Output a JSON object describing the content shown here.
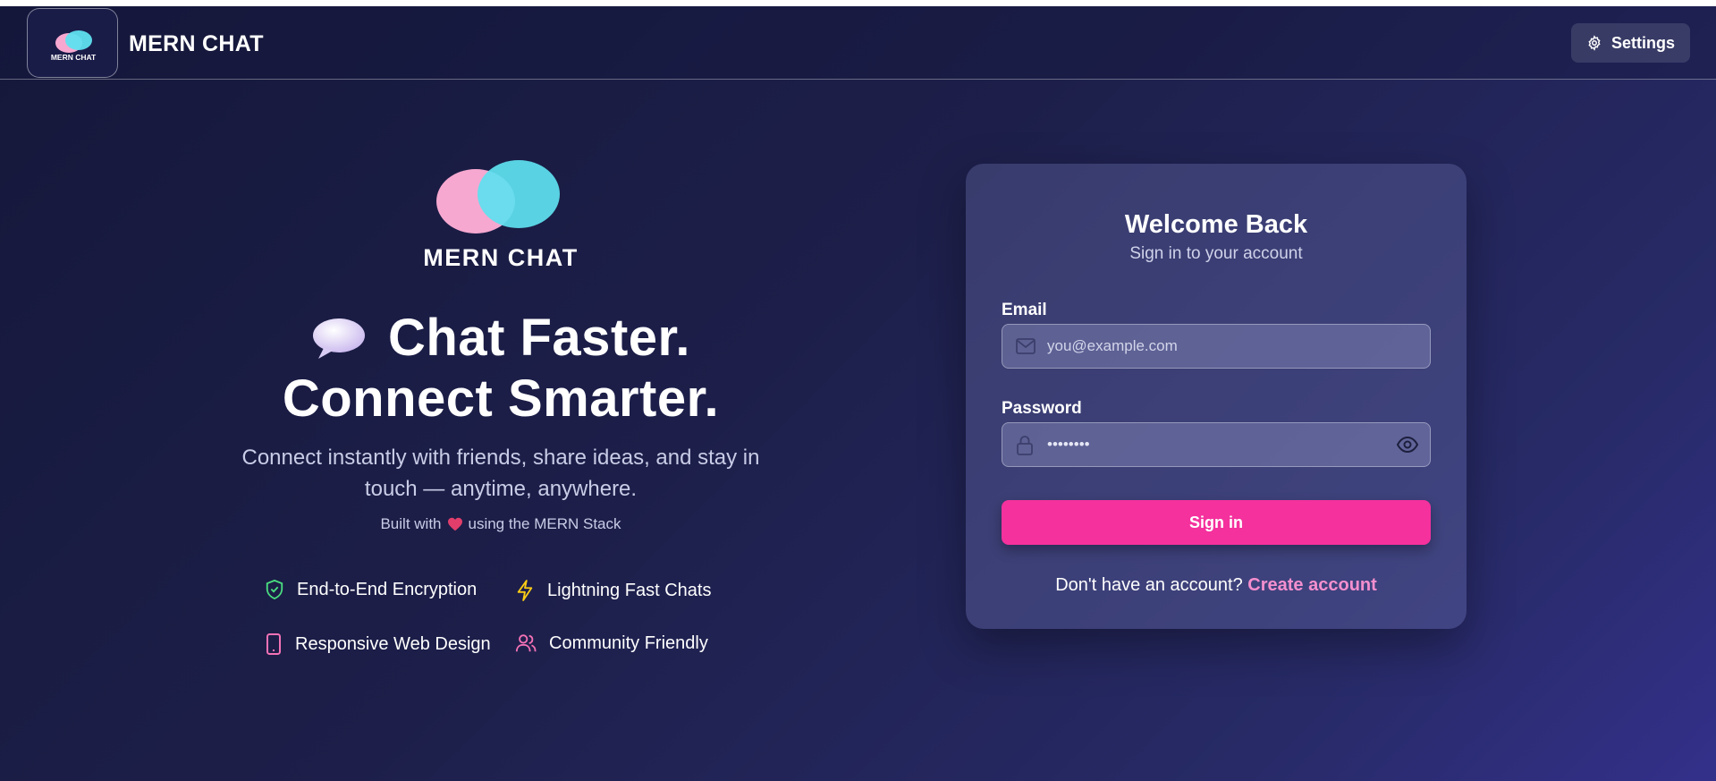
{
  "header": {
    "brand_name": "MERN CHAT",
    "logo_text": "MERN CHAT",
    "settings_label": "Settings"
  },
  "hero": {
    "logo_text": "MERN CHAT",
    "title_line1": "Chat Faster.",
    "title_line2": "Connect Smarter.",
    "subtitle": "Connect instantly with friends, share ideas, and stay in touch — anytime, anywhere.",
    "built_prefix": "Built with",
    "built_suffix": "using the MERN Stack",
    "features": [
      {
        "label": "End-to-End Encryption",
        "icon": "shield-check-icon",
        "color": "#4ade80"
      },
      {
        "label": "Lightning Fast Chats",
        "icon": "lightning-icon",
        "color": "#facc15"
      },
      {
        "label": "Responsive Web Design",
        "icon": "smartphone-icon",
        "color": "#f472b6"
      },
      {
        "label": "Community Friendly",
        "icon": "users-icon",
        "color": "#f472b6"
      }
    ]
  },
  "login": {
    "title": "Welcome Back",
    "subtitle": "Sign in to your account",
    "email_label": "Email",
    "email_placeholder": "you@example.com",
    "password_label": "Password",
    "password_value": "••••••••",
    "submit_label": "Sign in",
    "signup_prompt": "Don't have an account?",
    "signup_link": "Create account"
  },
  "colors": {
    "accent": "#f4319d",
    "link": "#f58fcf",
    "bubble_pink": "#f7a8d0",
    "bubble_cyan": "#5fe0ef"
  }
}
